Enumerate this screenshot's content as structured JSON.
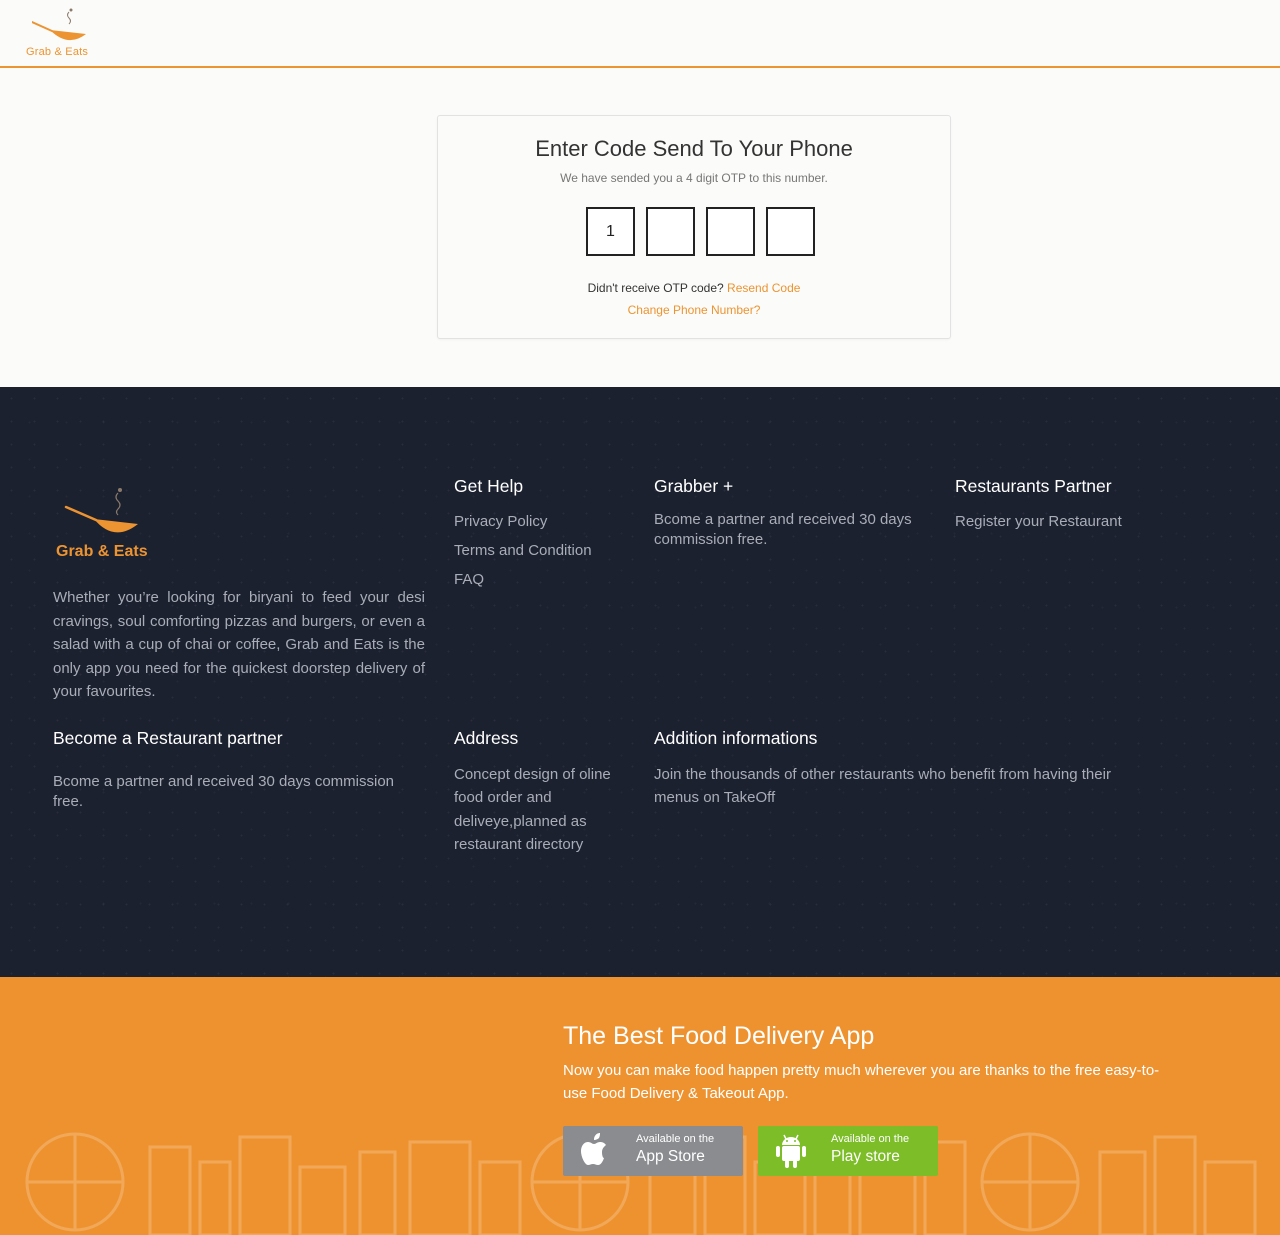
{
  "brand": {
    "name": "Grab & Eats",
    "accent_color": "#ec9431",
    "logo_icon": "wok-pan-icon"
  },
  "otp": {
    "title": "Enter Code Send To Your Phone",
    "subtitle": "We have sended you a 4 digit OTP to this number.",
    "digits": [
      "1",
      "",
      "",
      ""
    ],
    "resend_prompt": "Didn't receive OTP code?",
    "resend_label": "Resend Code",
    "change_label": "Change Phone Number?"
  },
  "footer": {
    "background_color": "#1c2130",
    "description": "Whether you’re looking for biryani to feed your desi cravings, soul comforting pizzas and burgers, or even a salad with a cup of chai or coffee, Grab and Eats is the only app you need for the quickest doorstep delivery of your favourites.",
    "get_help": {
      "heading": "Get Help",
      "links": [
        "Privacy Policy",
        "Terms and Condition",
        "FAQ"
      ]
    },
    "grabber_plus": {
      "heading": "Grabber +",
      "text": "Bcome a partner and received 30 days commission free."
    },
    "restaurants_partner": {
      "heading": "Restaurants Partner",
      "link": "Register your Restaurant"
    },
    "become_partner": {
      "heading": "Become a Restaurant partner",
      "text": "Bcome a partner and received 30 days commission free."
    },
    "address": {
      "heading": "Address",
      "text": "Concept design of oline food order and deliveye,planned as restaurant directory"
    },
    "additional": {
      "heading": "Addition informations",
      "text": "Join the thousands of other restaurants who benefit from having their menus on TakeOff"
    }
  },
  "app_banner": {
    "background_color": "#ee9230",
    "title": "The Best Food Delivery App",
    "subtitle": "Now you can make food happen pretty much wherever you are thanks to the free easy-to-use Food Delivery & Takeout App.",
    "app_store": {
      "small": "Available on the",
      "big": "App Store",
      "icon": "apple-icon",
      "color": "#8a8c90"
    },
    "play_store": {
      "small": "Available on the",
      "big": "Play store",
      "icon": "android-icon",
      "color": "#7cbd28"
    }
  }
}
